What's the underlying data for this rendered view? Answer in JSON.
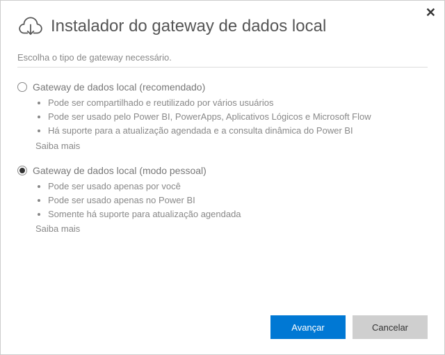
{
  "header": {
    "title": "Instalador do gateway de dados local"
  },
  "subtitle": "Escolha o tipo de gateway necessário.",
  "options": [
    {
      "label": "Gateway de dados local (recomendado)",
      "selected": false,
      "bullets": [
        "Pode ser compartilhado e reutilizado por vários usuários",
        "Pode ser usado pelo Power BI, PowerApps, Aplicativos Lógicos e Microsoft Flow",
        "Há suporte para a atualização agendada e a consulta dinâmica do Power BI"
      ],
      "learn_more": "Saiba mais"
    },
    {
      "label": "Gateway de dados local (modo pessoal)",
      "selected": true,
      "bullets": [
        "Pode ser usado apenas por você",
        "Pode ser usado apenas no Power BI",
        "Somente há suporte para atualização agendada"
      ],
      "learn_more": "Saiba mais"
    }
  ],
  "footer": {
    "next": "Avançar",
    "cancel": "Cancelar"
  }
}
